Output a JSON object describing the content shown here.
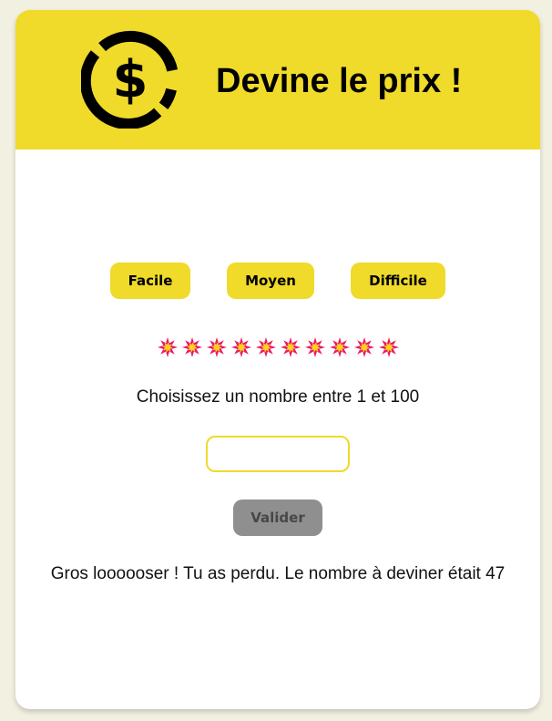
{
  "header": {
    "title": "Devine le prix !",
    "logo_icon": "dollar-circle-icon",
    "background_color": "#f0da2a"
  },
  "difficulty": {
    "easy_label": "Facile",
    "medium_label": "Moyen",
    "hard_label": "Difficile"
  },
  "lives": {
    "count": 10,
    "icon": "explosion-icon"
  },
  "instruction": "Choisissez un nombre entre 1 et 100",
  "guess_input": {
    "value": "",
    "placeholder": ""
  },
  "submit": {
    "label": "Valider",
    "state": "disabled"
  },
  "result_message": "Gros loooooser ! Tu as perdu. Le nombre à deviner était 47",
  "colors": {
    "accent": "#f0da2a",
    "page_background": "#f2f0e1",
    "disabled_button": "#8f8f8f",
    "life_icon": "#e8176b"
  }
}
